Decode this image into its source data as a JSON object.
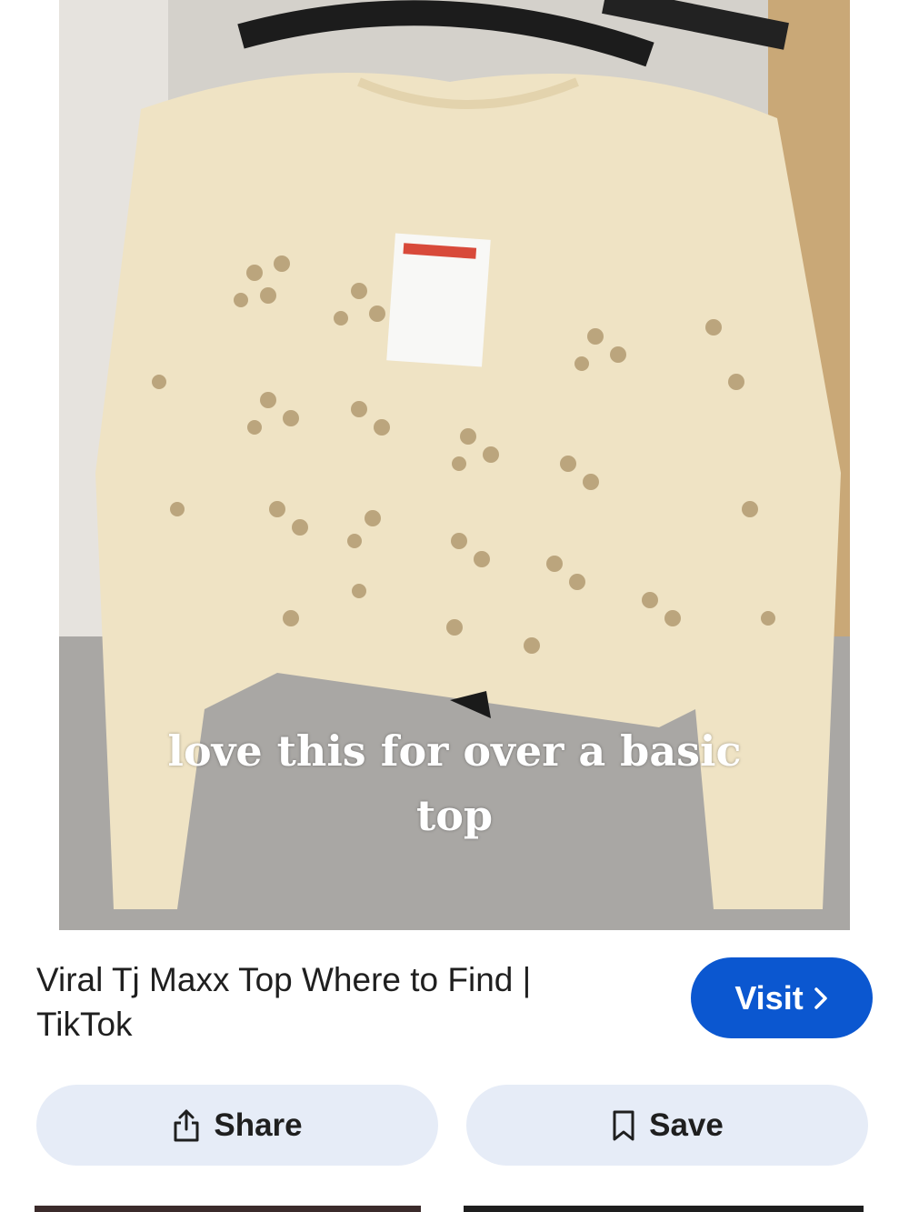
{
  "image": {
    "caption_line1": "love this for over a basic",
    "caption_line2": "top"
  },
  "result": {
    "title": "Viral Tj Maxx Top Where to Find | TikTok",
    "visit_label": "Visit"
  },
  "actions": {
    "share_label": "Share",
    "save_label": "Save"
  },
  "icons": {
    "visit": "chevron-right-icon",
    "share": "share-icon",
    "save": "bookmark-icon"
  },
  "colors": {
    "visit_button": "#0b57d0",
    "action_button": "#e6ecf7",
    "sweater": "#efe3c4"
  }
}
